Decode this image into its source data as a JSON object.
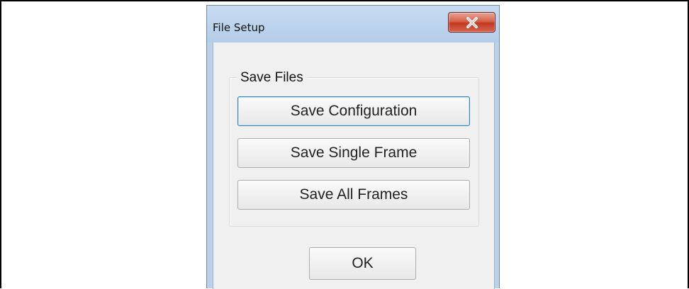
{
  "window": {
    "title": "File Setup",
    "close_icon": "close-icon"
  },
  "group": {
    "label": "Save Files"
  },
  "buttons": {
    "save_configuration": "Save Configuration",
    "save_single_frame": "Save Single Frame",
    "save_all_frames": "Save All Frames",
    "ok": "OK"
  },
  "colors": {
    "titlebar": "#b9d1ea",
    "close_button": "#c9452e",
    "client_background": "#f0f0f0",
    "focus_border": "#3c7fb1"
  }
}
